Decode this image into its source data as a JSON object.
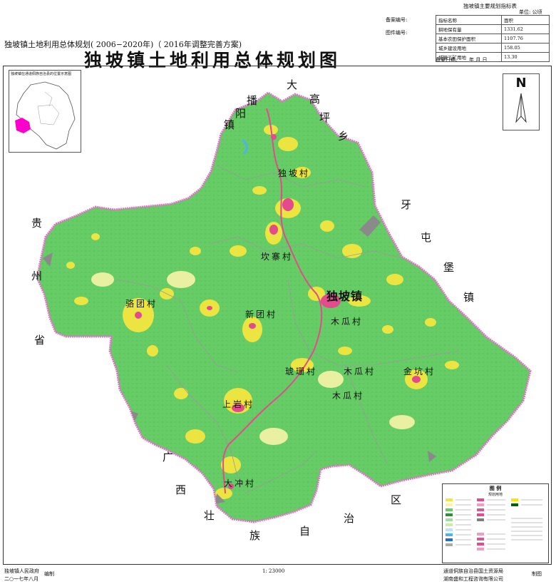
{
  "header": {
    "subtitle": "独坡镇土地利用总体规划( 2006−2020年)（  2016年调整完善方案)",
    "title": "独坡镇土地利用总体规划图",
    "record_no_label": "备案编号:",
    "drawing_no_label": "图件编号:",
    "record_date_label": "备案日期:",
    "record_date_value": "年    月    日"
  },
  "index_table": {
    "title": "独坡镇主要规划指标表",
    "unit": "单位: 公顷",
    "head": [
      "指标名称",
      "面积"
    ],
    "rows": [
      [
        "耕地保有量",
        "1331.62"
      ],
      [
        "基本农田保护面积",
        "1107.76"
      ],
      [
        "城乡建设用地",
        "158.05"
      ],
      [
        "城镇工矿用地",
        "13.30"
      ]
    ]
  },
  "inset": {
    "caption": "独坡镇在通道侗族自治县的位置示意图"
  },
  "north_arrow": {
    "letter": "N"
  },
  "neighbors": {
    "north_west": [
      "播",
      "阳",
      "镇"
    ],
    "north_east": [
      "大",
      "高",
      "坪",
      "乡"
    ],
    "east": [
      "牙",
      "屯",
      "堡",
      "镇"
    ],
    "west": [
      "贵",
      "州",
      "省"
    ],
    "south": [
      "广",
      "西",
      "壮",
      "族",
      "自",
      "治",
      "区"
    ]
  },
  "villages": {
    "dupo_village": "独坡村",
    "kanzhai": "坎寨村",
    "town_seat": "独坡镇",
    "gutuan": "骆团村",
    "xintuan": "新团村",
    "muguan1": "木瓜村",
    "muguan2": "木瓜村",
    "muguan3": "木瓜村",
    "hengling": "琥珊村",
    "jinkeng": "金坑村",
    "shangyan": "上岩村",
    "dachong": "大冲村"
  },
  "legend": {
    "title": "图   例",
    "subtitle": "规划用地",
    "colors": [
      "#f4e640",
      "#f8f4a8",
      "#66cc66",
      "#2f8f3a",
      "#9be09b",
      "#cfe9a6",
      "#e34b8d",
      "#f59ac0",
      "#d05a9c",
      "#b7e4f7",
      "#4db4e4",
      "#1f6fd1",
      "#aaaaaa",
      "#7f7f7f",
      "#ffe400",
      "#006400"
    ]
  },
  "footer": {
    "gov": "独坡镇人民政府",
    "date": "二○一七年八月",
    "compile": "编制",
    "scale": "1:  23000",
    "bureau": "通道侗族自治县国土资源局",
    "company": "湖南盛和工程咨询有限公司",
    "draw": "制图"
  },
  "colors": {
    "land": "#66cc66",
    "settlement": "#e34b8d",
    "farmland": "#f4e640",
    "border": "#e070c8"
  }
}
